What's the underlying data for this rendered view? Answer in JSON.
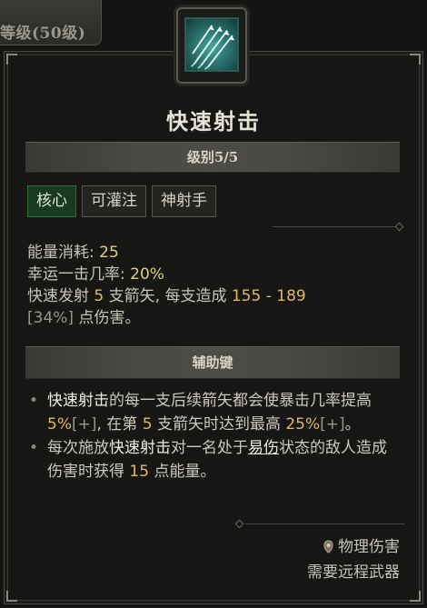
{
  "top_tab": {
    "label": "等级(50级)"
  },
  "skill": {
    "title": "快速射击",
    "icon": "arrows-volley-icon",
    "level_label": "级别5/5"
  },
  "tags": [
    {
      "label": "核心",
      "active": true
    },
    {
      "label": "可灌注",
      "active": false
    },
    {
      "label": "神射手",
      "active": false
    }
  ],
  "stats": {
    "energy_label": "能量消耗: ",
    "energy_value": "25",
    "crit_label": "幸运一击几率: ",
    "crit_value": "20%",
    "desc_pre": "快速发射 ",
    "desc_arrows": "5",
    "desc_mid": " 支箭矢, 每支造成 ",
    "desc_damage": "155 - 189",
    "desc_pct": "[34%]",
    "desc_post": " 点伤害。"
  },
  "modifier": {
    "header": "辅助键",
    "b1_skill": "快速射击",
    "b1_a": "的每一支后续箭矢都会使暴击几率提高 ",
    "b1_val1": "5%",
    "b1_plus1": "[+]",
    "b1_b": ", 在第 ",
    "b1_num": "5",
    "b1_c": " 支箭矢时达到最高 ",
    "b1_val2": "25%",
    "b1_plus2": "[+]",
    "b1_d": "。",
    "b2_a": "每次施放",
    "b2_skill": "快速射击",
    "b2_b": "对一名处于",
    "b2_status": "易伤",
    "b2_c": "状态的敌人造成伤害时获得 ",
    "b2_val": "15",
    "b2_d": " 点能量。"
  },
  "footer": {
    "damage_type": "物理伤害",
    "requirement": "需要远程武器"
  },
  "colors": {
    "core_tag_bg": "#183a20",
    "value_yellow": "#dcd07a",
    "value_orange": "#e2b85e",
    "icon_teal": "#2a7470"
  }
}
